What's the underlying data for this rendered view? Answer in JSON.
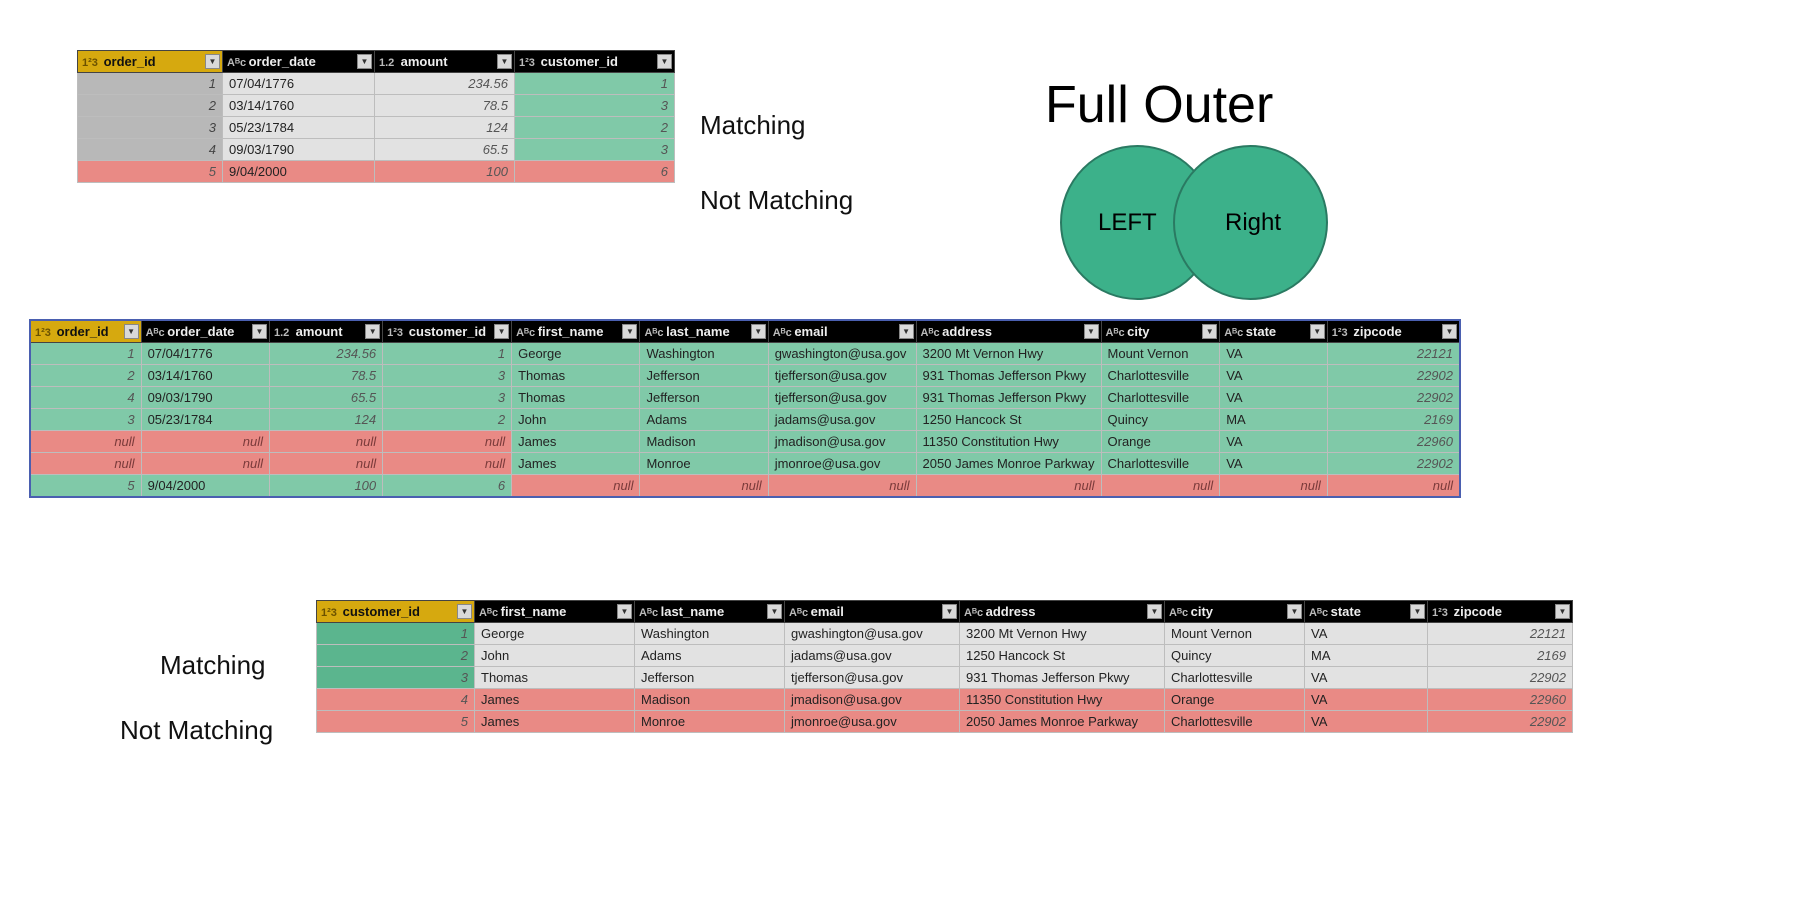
{
  "labels": {
    "matching": "Matching",
    "not_matching": "Not Matching",
    "title": "Full Outer",
    "left": "LEFT",
    "right": "Right"
  },
  "type_icons": {
    "int": "1²3",
    "text": "Aᴮc",
    "dec": "1.2"
  },
  "orders_table": {
    "headers": [
      "order_id",
      "order_date",
      "amount",
      "customer_id"
    ],
    "types": [
      "int",
      "text",
      "dec",
      "int"
    ],
    "rows": [
      {
        "order_id": "1",
        "order_date": "07/04/1776",
        "amount": "234.56",
        "customer_id": "1",
        "status": "match"
      },
      {
        "order_id": "2",
        "order_date": "03/14/1760",
        "amount": "78.5",
        "customer_id": "3",
        "status": "match"
      },
      {
        "order_id": "3",
        "order_date": "05/23/1784",
        "amount": "124",
        "customer_id": "2",
        "status": "match"
      },
      {
        "order_id": "4",
        "order_date": "09/03/1790",
        "amount": "65.5",
        "customer_id": "3",
        "status": "match"
      },
      {
        "order_id": "5",
        "order_date": "9/04/2000",
        "amount": "100",
        "customer_id": "6",
        "status": "nomatch"
      }
    ]
  },
  "full_outer_table": {
    "headers": [
      "order_id",
      "order_date",
      "amount",
      "customer_id",
      "first_name",
      "last_name",
      "email",
      "address",
      "city",
      "state",
      "zipcode"
    ],
    "types": [
      "int",
      "text",
      "dec",
      "int",
      "text",
      "text",
      "text",
      "text",
      "text",
      "text",
      "int"
    ],
    "rows": [
      {
        "vals": [
          "1",
          "07/04/1776",
          "234.56",
          "1",
          "George",
          "Washington",
          "gwashington@usa.gov",
          "3200 Mt Vernon Hwy",
          "Mount Vernon",
          "VA",
          "22121"
        ],
        "left": "green",
        "right": "green"
      },
      {
        "vals": [
          "2",
          "03/14/1760",
          "78.5",
          "3",
          "Thomas",
          "Jefferson",
          "tjefferson@usa.gov",
          "931 Thomas Jefferson Pkwy",
          "Charlottesville",
          "VA",
          "22902"
        ],
        "left": "green",
        "right": "green"
      },
      {
        "vals": [
          "4",
          "09/03/1790",
          "65.5",
          "3",
          "Thomas",
          "Jefferson",
          "tjefferson@usa.gov",
          "931 Thomas Jefferson Pkwy",
          "Charlottesville",
          "VA",
          "22902"
        ],
        "left": "green",
        "right": "green"
      },
      {
        "vals": [
          "3",
          "05/23/1784",
          "124",
          "2",
          "John",
          "Adams",
          "jadams@usa.gov",
          "1250 Hancock St",
          "Quincy",
          "MA",
          "2169"
        ],
        "left": "green",
        "right": "green"
      },
      {
        "vals": [
          "null",
          "null",
          "null",
          "null",
          "James",
          "Madison",
          "jmadison@usa.gov",
          "11350 Constitution Hwy",
          "Orange",
          "VA",
          "22960"
        ],
        "left": "red",
        "right": "green"
      },
      {
        "vals": [
          "null",
          "null",
          "null",
          "null",
          "James",
          "Monroe",
          "jmonroe@usa.gov",
          "2050 James Monroe Parkway",
          "Charlottesville",
          "VA",
          "22902"
        ],
        "left": "red",
        "right": "green"
      },
      {
        "vals": [
          "5",
          "9/04/2000",
          "100",
          "6",
          "null",
          "null",
          "null",
          "null",
          "null",
          "null",
          "null"
        ],
        "left": "green",
        "right": "red"
      }
    ]
  },
  "customers_table": {
    "headers": [
      "customer_id",
      "first_name",
      "last_name",
      "email",
      "address",
      "city",
      "state",
      "zipcode"
    ],
    "types": [
      "int",
      "text",
      "text",
      "text",
      "text",
      "text",
      "text",
      "int"
    ],
    "rows": [
      {
        "vals": [
          "1",
          "George",
          "Washington",
          "gwashington@usa.gov",
          "3200 Mt Vernon Hwy",
          "Mount Vernon",
          "VA",
          "22121"
        ],
        "status": "match"
      },
      {
        "vals": [
          "2",
          "John",
          "Adams",
          "jadams@usa.gov",
          "1250 Hancock St",
          "Quincy",
          "MA",
          "2169"
        ],
        "status": "match"
      },
      {
        "vals": [
          "3",
          "Thomas",
          "Jefferson",
          "tjefferson@usa.gov",
          "931 Thomas Jefferson Pkwy",
          "Charlottesville",
          "VA",
          "22902"
        ],
        "status": "match"
      },
      {
        "vals": [
          "4",
          "James",
          "Madison",
          "jmadison@usa.gov",
          "11350 Constitution Hwy",
          "Orange",
          "VA",
          "22960"
        ],
        "status": "nomatch"
      },
      {
        "vals": [
          "5",
          "James",
          "Monroe",
          "jmonroe@usa.gov",
          "2050 James Monroe Parkway",
          "Charlottesville",
          "VA",
          "22902"
        ],
        "status": "nomatch"
      }
    ]
  }
}
